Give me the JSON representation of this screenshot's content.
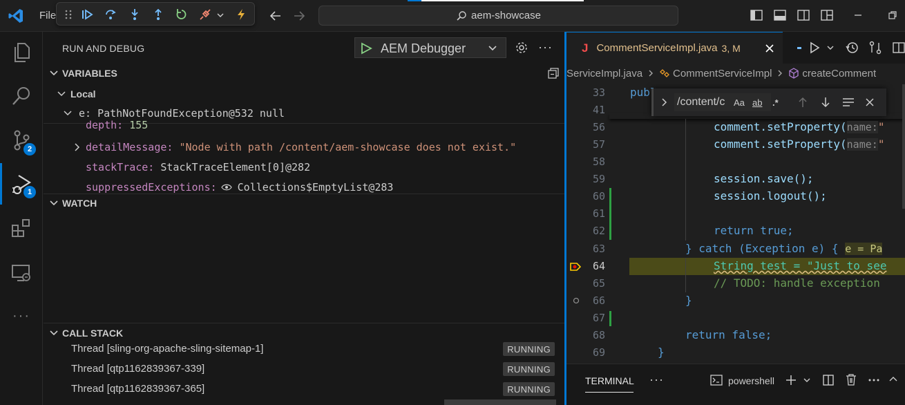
{
  "titlebar": {
    "menu_file": "File",
    "search_text": "aem-showcase"
  },
  "activity": {
    "scm_badge": "2",
    "debug_badge": "1"
  },
  "sidebar": {
    "title": "RUN AND DEBUG",
    "config": "AEM Debugger",
    "more": "···",
    "variables_header": "VARIABLES",
    "local_label": "Local",
    "exception_var": {
      "name": "e:",
      "value": "PathNotFoundException@532 null"
    },
    "vars": [
      {
        "name": "depth:",
        "value": "155",
        "kind": "num"
      },
      {
        "name": "detailMessage:",
        "value": "\"Node with path /content/aem-showcase does not exist.\"",
        "kind": "str"
      },
      {
        "name": "stackTrace:",
        "value": "StackTraceElement[0]@282",
        "kind": "plain"
      },
      {
        "name": "suppressedExceptions:",
        "value": "Collections$EmptyList@283",
        "kind": "plain"
      }
    ],
    "watch_header": "WATCH",
    "callstack_header": "CALL STACK",
    "threads": [
      {
        "name": "Thread [sling-org-apache-sling-sitemap-1]",
        "status": "RUNNING"
      },
      {
        "name": "Thread [qtp1162839367-339]",
        "status": "RUNNING"
      },
      {
        "name": "Thread [qtp1162839367-365]",
        "status": "RUNNING"
      }
    ]
  },
  "editor": {
    "tab_icon": "J",
    "tab_file": "CommentServiceImpl.java",
    "tab_status": "3, M",
    "breadcrumb": [
      "ServiceImpl.java",
      "CommentServiceImpl",
      "createComment"
    ],
    "find_value": "/content/c",
    "find_case": "Aa",
    "find_word": "ab",
    "find_regex": ".*",
    "lines": [
      {
        "n": "33",
        "code": "publ"
      },
      {
        "n": "41",
        "code": ""
      },
      {
        "n": "56",
        "code": "comment.setProperty("
      },
      {
        "n": "57",
        "code": "comment.setProperty("
      },
      {
        "n": "58",
        "code": ""
      },
      {
        "n": "59",
        "code": "session.save();"
      },
      {
        "n": "60",
        "code": "session.logout();"
      },
      {
        "n": "61",
        "code": ""
      },
      {
        "n": "62",
        "code": "return true;"
      },
      {
        "n": "63",
        "code": "} catch (Exception e) {"
      },
      {
        "n": "64",
        "code": "String test = \"Just to see"
      },
      {
        "n": "65",
        "code": "// TODO: handle exception"
      },
      {
        "n": "66",
        "code": "}"
      },
      {
        "n": "67",
        "code": ""
      },
      {
        "n": "68",
        "code": "return false;"
      },
      {
        "n": "69",
        "code": "}"
      }
    ],
    "hint_name": "name:",
    "hint_e": "e = Pa"
  },
  "panel": {
    "terminal_tab": "TERMINAL",
    "shell": "powershell"
  }
}
